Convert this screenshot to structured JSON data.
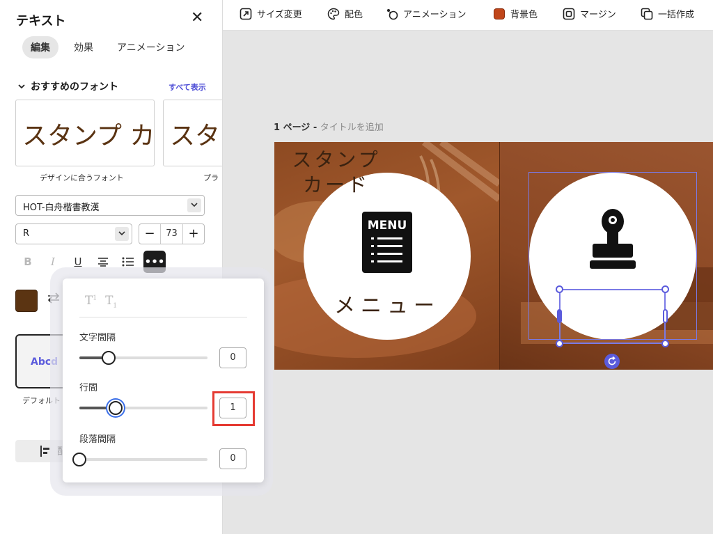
{
  "panel": {
    "title": "テキスト",
    "close_label": "✕",
    "tabs": [
      "編集",
      "効果",
      "アニメーション"
    ],
    "section_title": "おすすめのフォント",
    "see_all": "すべて表示",
    "font_cards": [
      {
        "preview": "スタンプ カ",
        "caption": "デザインに合うフォント"
      },
      {
        "preview": "スタン",
        "caption": "プラ"
      }
    ],
    "font_family_value": "HOT-白舟楷書教漢",
    "font_weight_value": "R",
    "font_size": {
      "minus": "−",
      "value": "73",
      "plus": "+"
    },
    "format_buttons": {
      "bold": "B",
      "italic": "I",
      "underline": "U",
      "more": "•••"
    },
    "text_color": "#5b3412",
    "style_preset_label": "Abcd",
    "style_preset_caption": "デフォルト",
    "align_label": "配"
  },
  "toolbar": {
    "items": [
      "サイズ変更",
      "配色",
      "アニメーション",
      "背景色",
      "マージン",
      "一括作成"
    ],
    "bg_color": "#c0461a"
  },
  "canvas": {
    "page_number": "1 ページ - ",
    "page_title_placeholder": "タイトルを追加",
    "menu_icon_text": "MENU",
    "menu_label": "メニュー",
    "stamp_label_line1": "スタンプ",
    "stamp_label_line2": "カード"
  },
  "spacing_popup": {
    "letter_spacing_label": "文字間隔",
    "letter_spacing_value": "0",
    "letter_spacing_level": 0.23,
    "line_height_label": "行間",
    "line_height_value": "1",
    "line_height_level": 0.28,
    "paragraph_spacing_label": "段落間隔",
    "paragraph_spacing_value": "0",
    "paragraph_spacing_level": 0
  }
}
